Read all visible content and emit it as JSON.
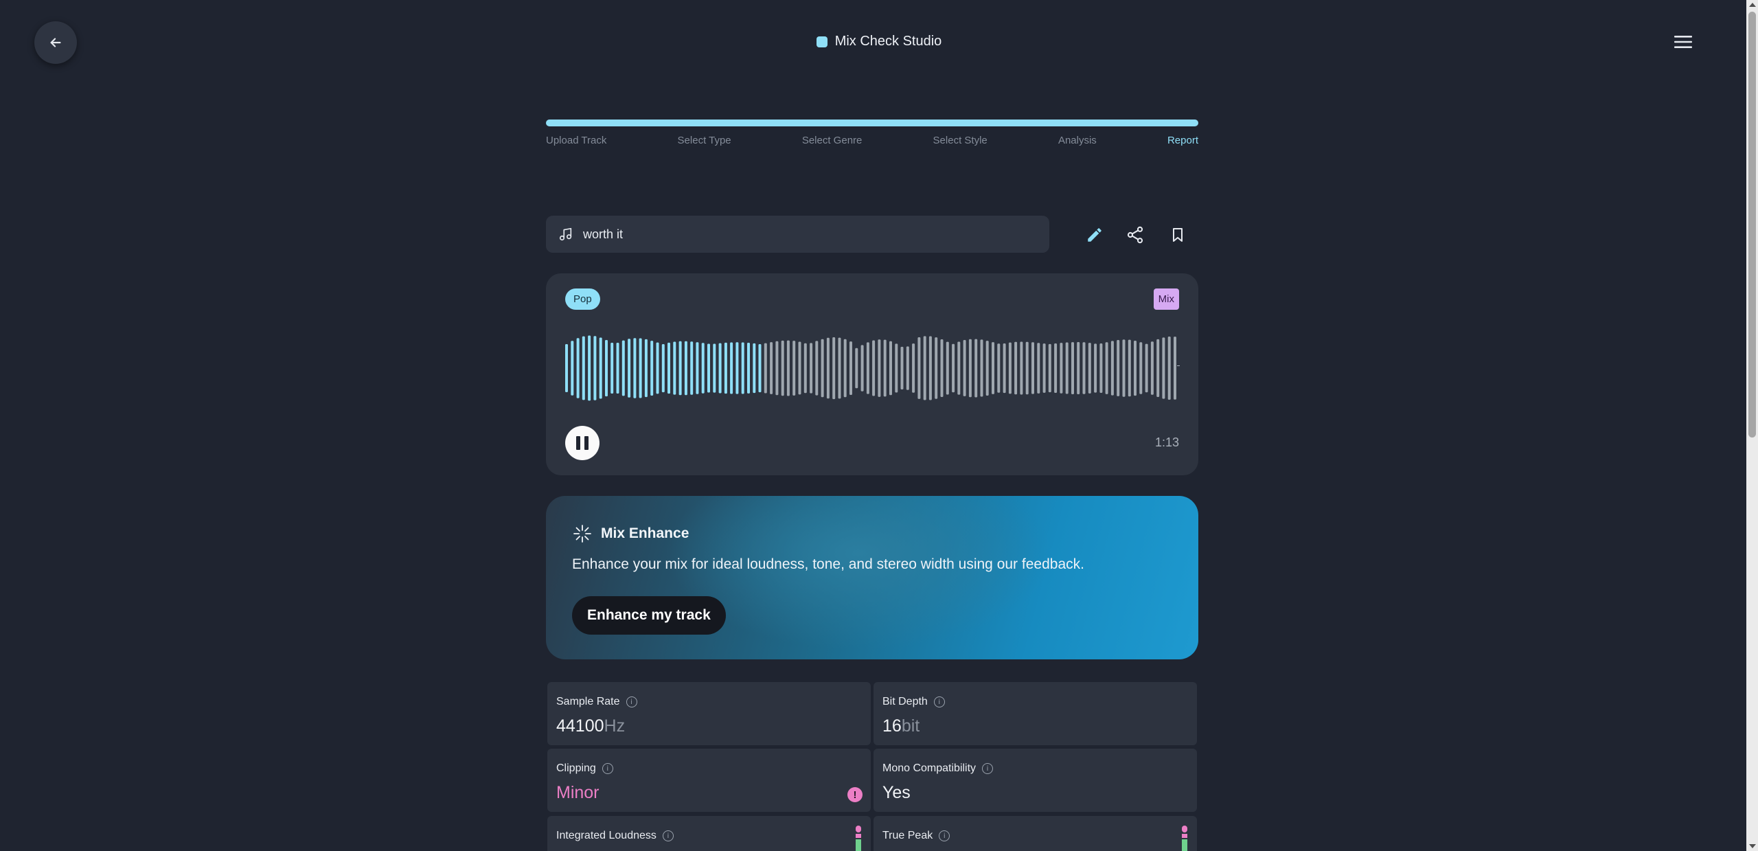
{
  "app": {
    "title": "Mix Check Studio"
  },
  "steps": [
    {
      "label": "Upload Track",
      "active": false
    },
    {
      "label": "Select Type",
      "active": false
    },
    {
      "label": "Select Genre",
      "active": false
    },
    {
      "label": "Select Style",
      "active": false
    },
    {
      "label": "Analysis",
      "active": false
    },
    {
      "label": "Report",
      "active": true
    }
  ],
  "progress": {
    "fraction": 1.0
  },
  "track": {
    "name": "worth it"
  },
  "player": {
    "genre_tag": "Pop",
    "type_tag": "Mix",
    "time": "1:13",
    "state": "playing",
    "played_fraction": 0.32
  },
  "enhance": {
    "title": "Mix Enhance",
    "description": "Enhance your mix for ideal loudness, tone, and stereo width using our feedback.",
    "button_label": "Enhance my track"
  },
  "metrics": {
    "sample_rate": {
      "label": "Sample Rate",
      "value": "44100",
      "unit": "Hz"
    },
    "bit_depth": {
      "label": "Bit Depth",
      "value": "16",
      "unit": "bit"
    },
    "clipping": {
      "label": "Clipping",
      "value": "Minor"
    },
    "mono": {
      "label": "Mono Compatibility",
      "value": "Yes"
    },
    "integrated_loudness": {
      "label": "Integrated Loudness"
    },
    "true_peak": {
      "label": "True Peak"
    }
  },
  "colors": {
    "accent": "#8fdff7",
    "warning": "#ec7fc6",
    "background": "#1f2430",
    "card": "#2d333f"
  },
  "icons": {
    "back": "arrow-left-icon",
    "menu": "hamburger-menu-icon",
    "track": "music-note-icon",
    "edit": "pencil-icon",
    "share": "share-icon",
    "save": "bookmark-icon",
    "enhance": "sparkle-icon",
    "info": "info-icon"
  }
}
